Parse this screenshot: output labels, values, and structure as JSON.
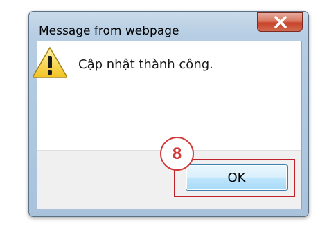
{
  "window": {
    "title": "Message from webpage",
    "close_icon": "close-x-icon"
  },
  "dialog": {
    "icon": "warning-triangle-icon",
    "message": "Cập nhật thành công.",
    "ok_label": "OK"
  },
  "annotation": {
    "step_number": "8",
    "highlight_color": "#c0212d"
  }
}
